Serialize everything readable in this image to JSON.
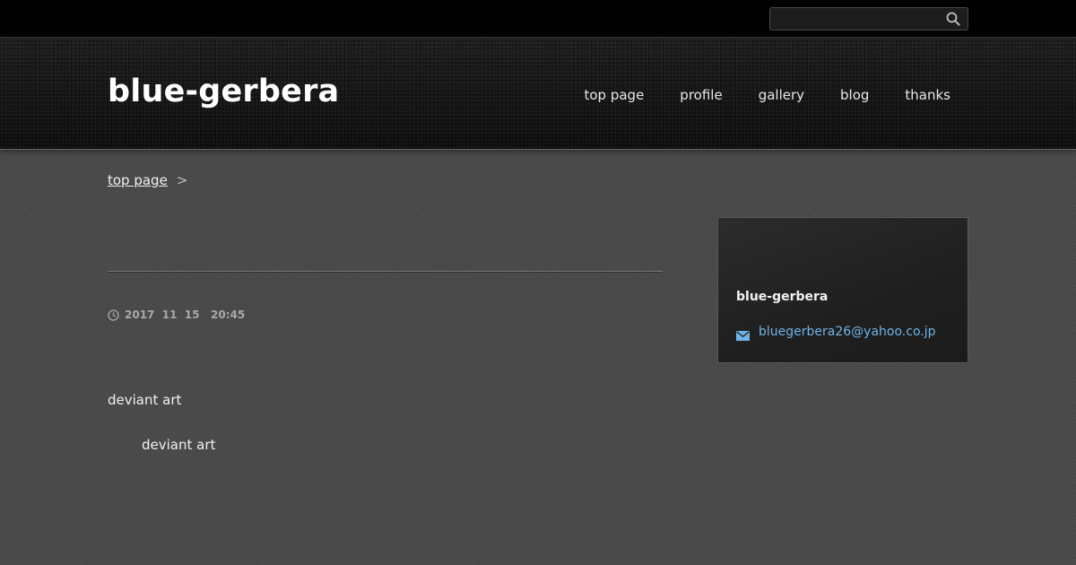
{
  "topbar": {
    "search": {
      "value": "",
      "placeholder": ""
    }
  },
  "header": {
    "site_title": "blue-gerbera",
    "nav": [
      "top page",
      "profile",
      "gallery",
      "blog",
      "thanks"
    ]
  },
  "breadcrumb": {
    "home": "top page",
    "separator": ">"
  },
  "article": {
    "date": "2017  11  15   20:45",
    "paragraphs": [
      "deviant art",
      "deviant art"
    ]
  },
  "sidebar": {
    "profile_name": "blue-gerbera",
    "email": "bluegerbera26@yahoo.co.jp"
  },
  "colors": {
    "link_blue": "#6fb4e6",
    "topbar": "#000000",
    "header": "#151515",
    "page_bg": "#4a4a4a"
  }
}
